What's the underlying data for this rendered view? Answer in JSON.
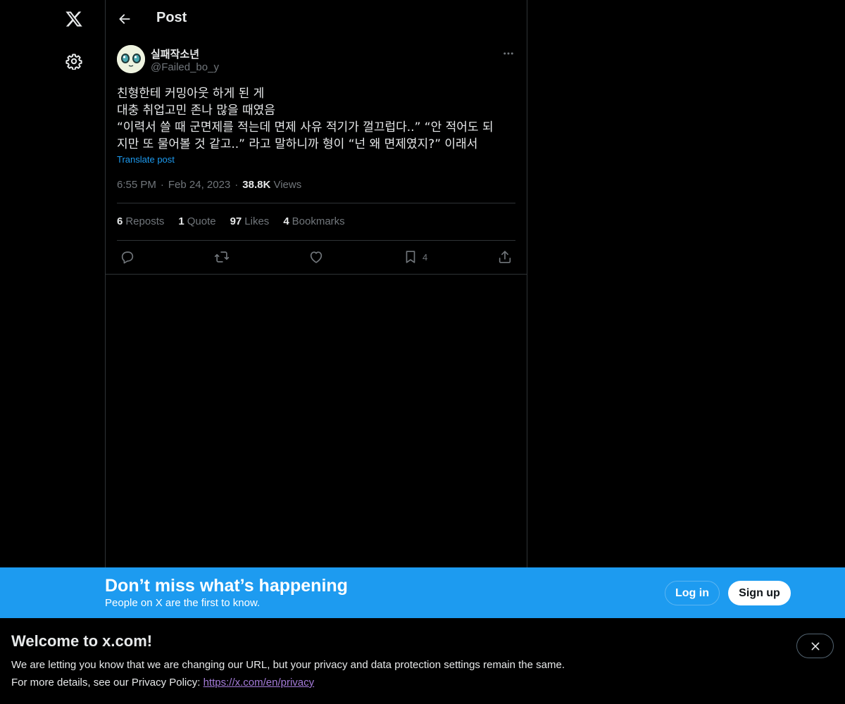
{
  "header": {
    "title": "Post"
  },
  "post": {
    "author": {
      "name": "실패작소년",
      "handle": "@Failed_bo_y"
    },
    "body_lines": [
      "친형한테 커밍아웃 하게 된 게",
      "대충 취업고민 존나 많을 때였음",
      "“이력서 쓸 때 군면제를 적는데 면제 사유 적기가 껄끄럽다..” “안 적어도 되",
      "지만 또 물어볼 것 같고..” 라고 말하니까 형이 “넌 왜 면제였지?” 이래서"
    ],
    "translate_label": "Translate post",
    "time": "6:55 PM",
    "date": "Feb 24, 2023",
    "views_count": "38.8K",
    "views_label": "Views",
    "stats": {
      "reposts": {
        "count": "6",
        "label": "Reposts"
      },
      "quotes": {
        "count": "1",
        "label": "Quote"
      },
      "likes": {
        "count": "97",
        "label": "Likes"
      },
      "bookmarks": {
        "count": "4",
        "label": "Bookmarks"
      }
    },
    "actions": {
      "reply_icon": "reply-icon",
      "repost_icon": "repost-icon",
      "like_icon": "heart-icon",
      "bookmark_icon": "bookmark-icon",
      "bookmark_count": "4",
      "share_icon": "share-icon"
    }
  },
  "banner": {
    "title": "Don’t miss what’s happening",
    "subtitle": "People on X are the first to know.",
    "login_label": "Log in",
    "signup_label": "Sign up",
    "color": "#1d9bf0"
  },
  "welcome": {
    "title": "Welcome to x.com!",
    "line1": "We are letting you know that we are changing our URL, but your privacy and data protection settings remain the same.",
    "line2_prefix": "For more details, see our Privacy Policy: ",
    "link_text": "https://x.com/en/privacy"
  },
  "colors": {
    "background": "#000000",
    "text": "#e7e9ea",
    "muted": "#71767b",
    "border": "#2f3336",
    "link": "#1d9bf0"
  }
}
